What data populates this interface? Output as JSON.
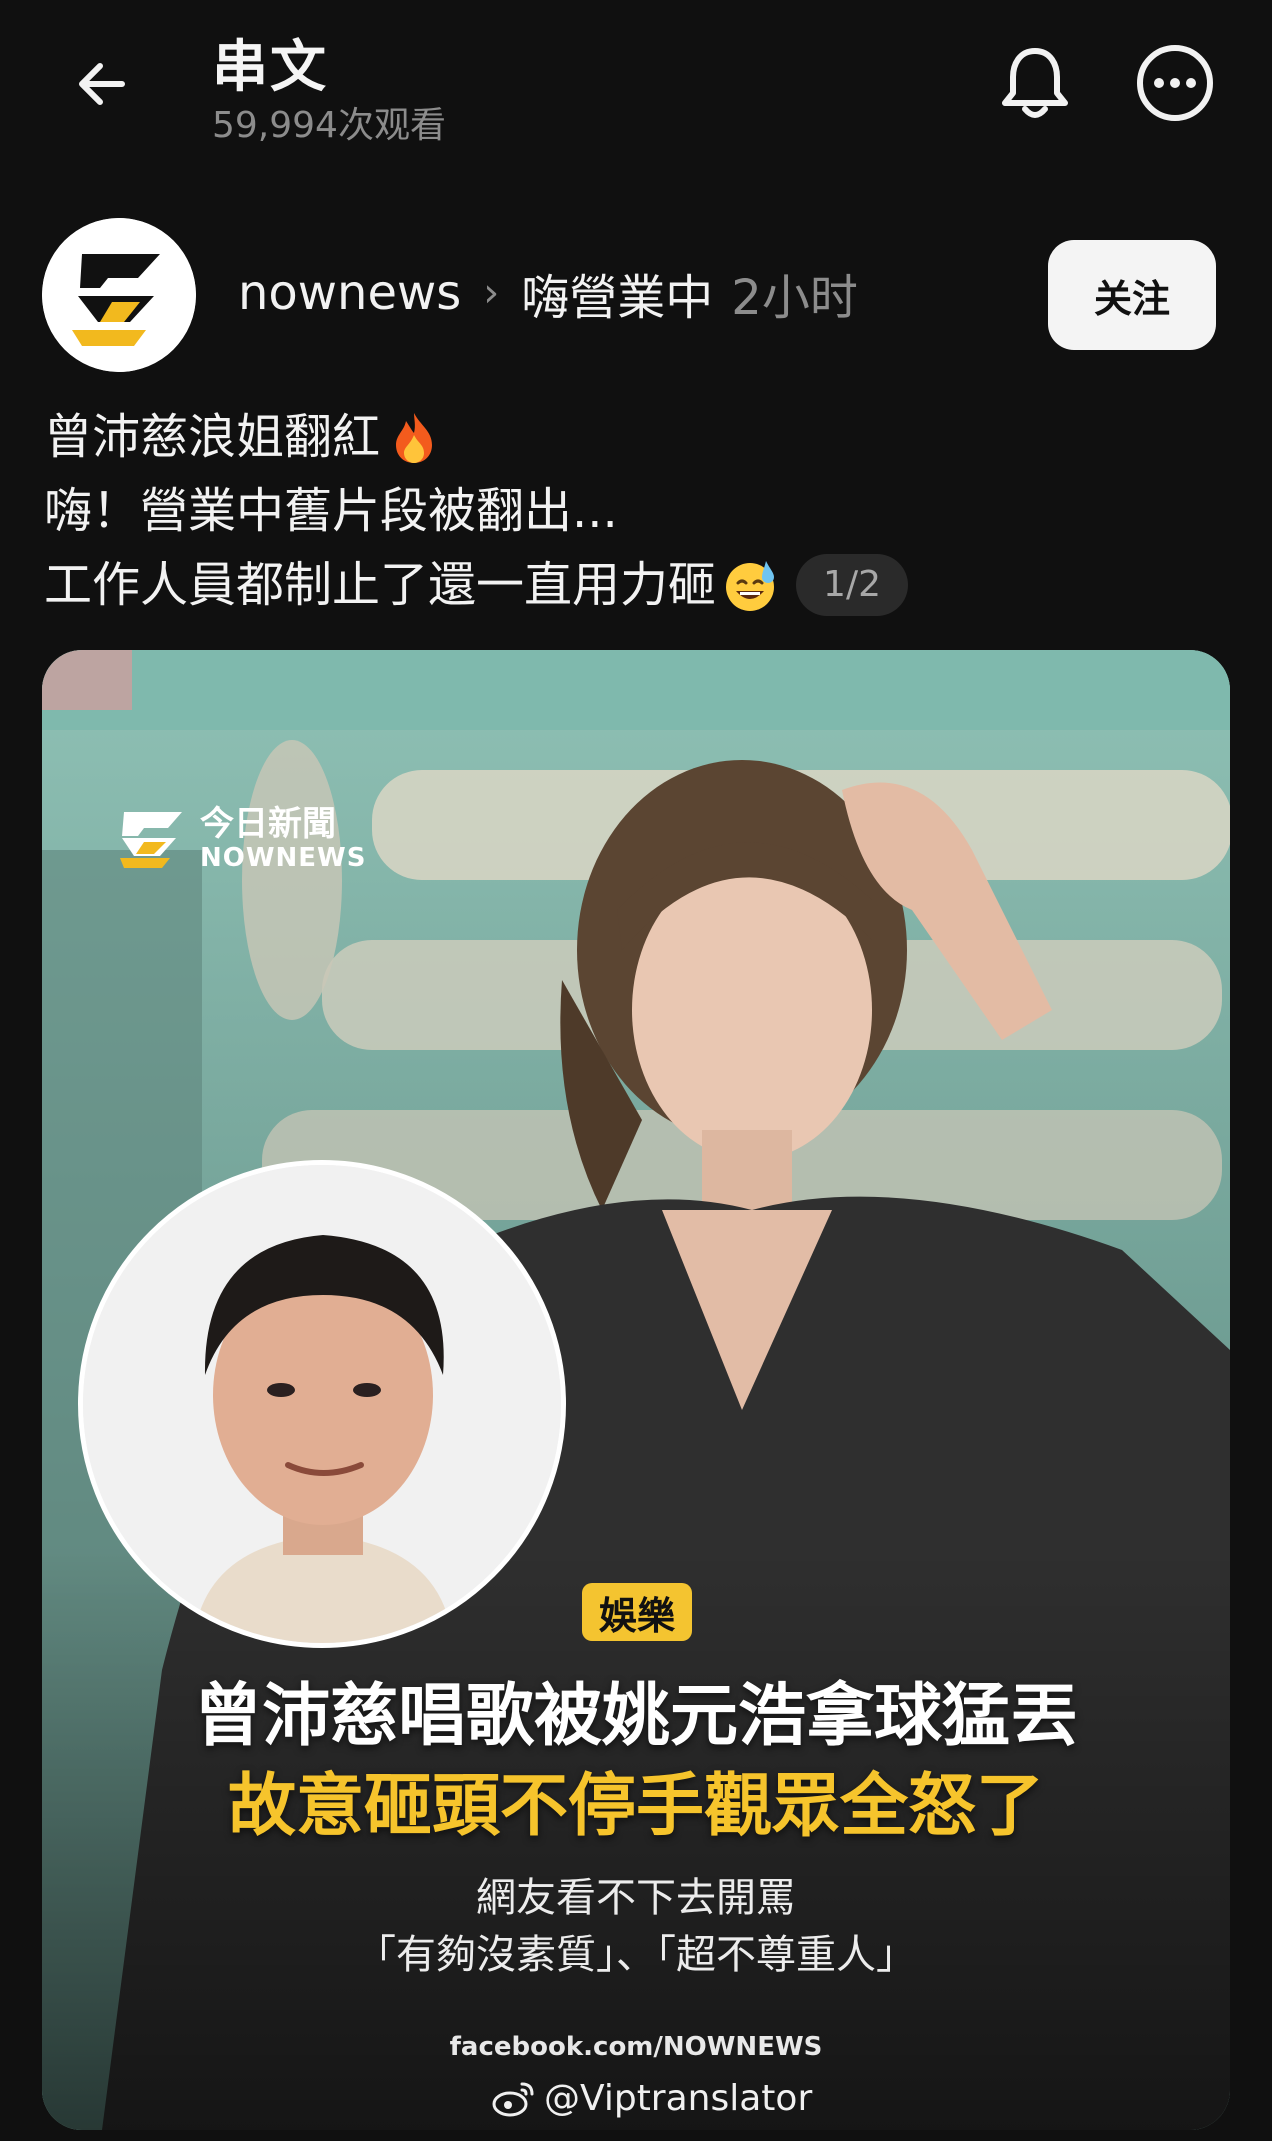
{
  "header": {
    "title": "串文",
    "views": "59,994次观看",
    "icons": {
      "back": "arrow-left-icon",
      "bell": "bell-icon",
      "more": "more-horizontal-icon"
    }
  },
  "post": {
    "author": "nownews",
    "separator": "›",
    "channel": "嗨營業中",
    "time": "2小时",
    "follow_label": "关注",
    "caption_lines": [
      "曾沛慈浪姐翻紅",
      "嗨！營業中舊片段被翻出...",
      "工作人員都制止了還一直用力砸"
    ],
    "emojis": [
      "fire-emoji",
      "sweat-smile-emoji"
    ],
    "pager": "1/2"
  },
  "media": {
    "brand_cn": "今日新聞",
    "brand_en": "NOWNEWS",
    "tag": "娛樂",
    "headline_1": "曾沛慈唱歌被姚元浩拿球猛丟",
    "headline_2": "故意砸頭不停手觀眾全怒了",
    "sub_1": "網友看不下去開罵",
    "sub_2": "「有夠沒素質」、「超不尊重人」",
    "source": "facebook.com/NOWNEWS",
    "watermark": "@Viptranslator"
  },
  "colors": {
    "background": "#101010",
    "text_primary": "#f2f2f2",
    "text_secondary": "#8c8c8c",
    "follow_bg": "#f4f4f4",
    "tag_yellow": "#f4c430",
    "headline_yellow": "#f6c42c",
    "brand_yellow": "#f2b91e"
  }
}
